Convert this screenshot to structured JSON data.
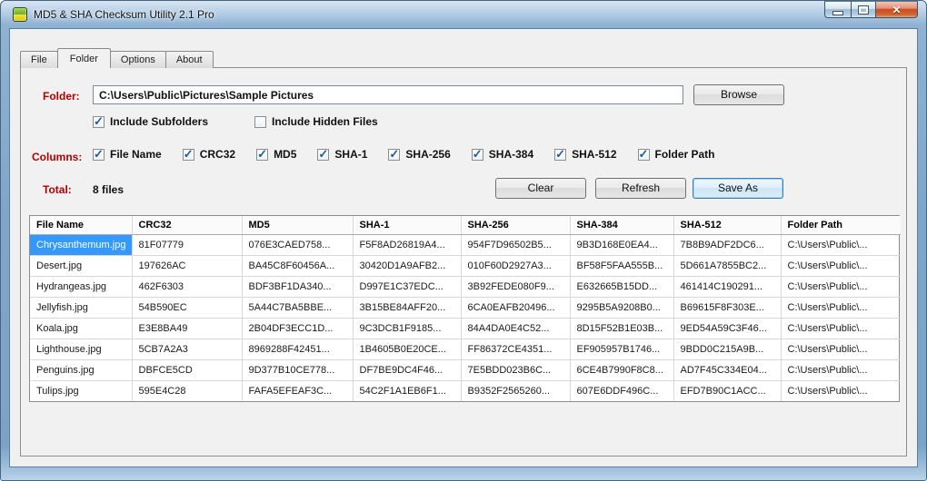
{
  "window": {
    "title": "MD5 & SHA Checksum Utility 2.1 Pro"
  },
  "tabs": [
    {
      "label": "File",
      "active": false
    },
    {
      "label": "Folder",
      "active": true
    },
    {
      "label": "Options",
      "active": false
    },
    {
      "label": "About",
      "active": false
    }
  ],
  "folder": {
    "label": "Folder:",
    "path": "C:\\Users\\Public\\Pictures\\Sample Pictures",
    "browse_label": "Browse",
    "include_subfolders": {
      "label": "Include Subfolders",
      "checked": true
    },
    "include_hidden_files": {
      "label": "Include Hidden Files",
      "checked": false
    }
  },
  "columns_section": {
    "label": "Columns:",
    "options": [
      {
        "label": "File Name",
        "checked": true
      },
      {
        "label": "CRC32",
        "checked": true
      },
      {
        "label": "MD5",
        "checked": true
      },
      {
        "label": "SHA-1",
        "checked": true
      },
      {
        "label": "SHA-256",
        "checked": true
      },
      {
        "label": "SHA-384",
        "checked": true
      },
      {
        "label": "SHA-512",
        "checked": true
      },
      {
        "label": "Folder Path",
        "checked": true
      }
    ]
  },
  "total": {
    "label": "Total:",
    "value": "8 files"
  },
  "buttons": {
    "clear": "Clear",
    "refresh": "Refresh",
    "save_as": "Save As"
  },
  "table": {
    "headers": [
      "File Name",
      "CRC32",
      "MD5",
      "SHA-1",
      "SHA-256",
      "SHA-384",
      "SHA-512",
      "Folder Path"
    ],
    "selected": {
      "row": 0,
      "col": 0
    },
    "rows": [
      [
        "Chrysanthemum.jpg",
        "81F07779",
        "076E3CAED758...",
        "F5F8AD26819A4...",
        "954F7D96502B5...",
        "9B3D168E0EA4...",
        "7B8B9ADF2DC6...",
        "C:\\Users\\Public\\..."
      ],
      [
        "Desert.jpg",
        "197626AC",
        "BA45C8F60456A...",
        "30420D1A9AFB2...",
        "010F60D2927A3...",
        "BF58F5FAA555B...",
        "5D661A7855BC2...",
        "C:\\Users\\Public\\..."
      ],
      [
        "Hydrangeas.jpg",
        "462F6303",
        "BDF3BF1DA340...",
        "D997E1C37EDC...",
        "3B92FEDE080F9...",
        "E632665B15DD...",
        "461414C190291...",
        "C:\\Users\\Public\\..."
      ],
      [
        "Jellyfish.jpg",
        "54B590EC",
        "5A44C7BA5BBE...",
        "3B15BE84AFF20...",
        "6CA0EAFB20496...",
        "9295B5A9208B0...",
        "B69615F8F303E...",
        "C:\\Users\\Public\\..."
      ],
      [
        "Koala.jpg",
        "E3E8BA49",
        "2B04DF3ECC1D...",
        "9C3DCB1F9185...",
        "84A4DA0E4C52...",
        "8D15F52B1E03B...",
        "9ED54A59C3F46...",
        "C:\\Users\\Public\\..."
      ],
      [
        "Lighthouse.jpg",
        "5CB7A2A3",
        "8969288F42451...",
        "1B4605B0E20CE...",
        "FF86372CE4351...",
        "EF905957B1746...",
        "9BDD0C215A9B...",
        "C:\\Users\\Public\\..."
      ],
      [
        "Penguins.jpg",
        "DBFCE5CD",
        "9D377B10CE778...",
        "DF7BE9DC4F46...",
        "7E5BDD023B6C...",
        "6CE4B7990F8C8...",
        "AD7F45C334E04...",
        "C:\\Users\\Public\\..."
      ],
      [
        "Tulips.jpg",
        "595E4C28",
        "FAFA5EFEAF3C...",
        "54C2F1A1EB6F1...",
        "B9352F2565260...",
        "607E6DDF496C...",
        "EFD7B90C1ACC...",
        "C:\\Users\\Public\\..."
      ]
    ]
  }
}
